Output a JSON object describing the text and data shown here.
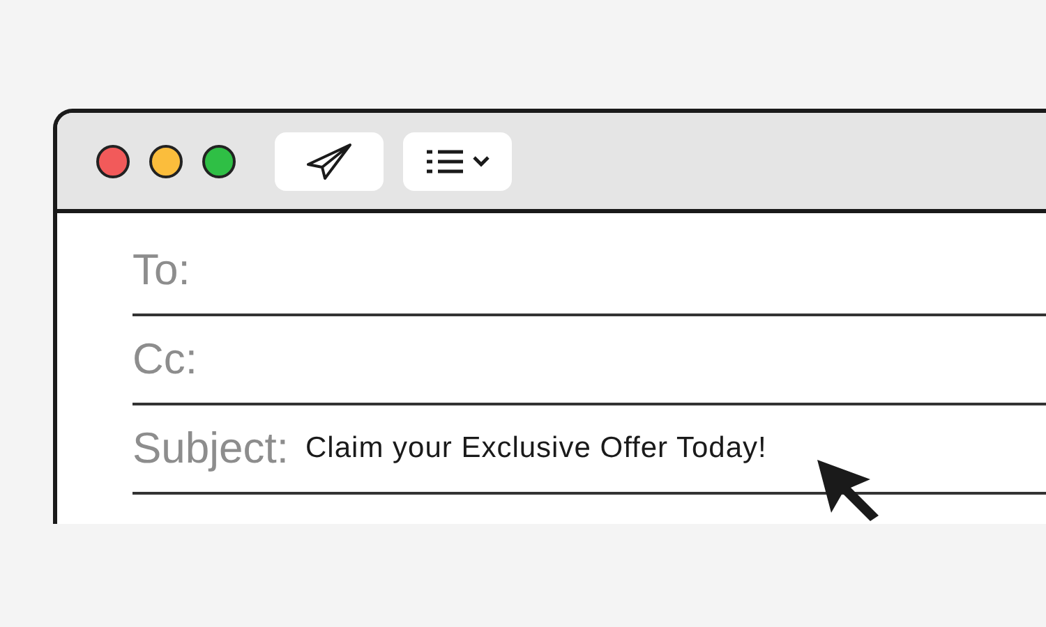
{
  "window_controls": [
    {
      "color": "#f25a5a"
    },
    {
      "color": "#fbbd3c"
    },
    {
      "color": "#2fbf45"
    }
  ],
  "fields": [
    {
      "label": "To:"
    },
    {
      "label": "Cc:"
    },
    {
      "label": "Subject:",
      "value": "Claim your Exclusive Offer Today!"
    }
  ]
}
